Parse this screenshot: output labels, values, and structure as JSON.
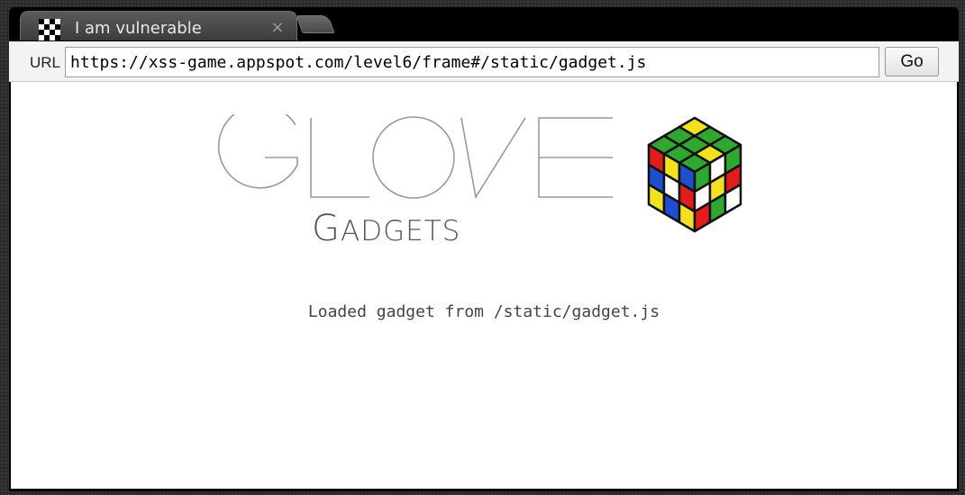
{
  "browser": {
    "tab": {
      "title": "I am vulnerable",
      "close_symbol": "×",
      "favicon": "xss-game-favicon-icon"
    },
    "new_tab": "new-tab-button",
    "toolbar": {
      "url_label": "URL",
      "url_value": "https://xss-game.appspot.com/level6/frame#/static/gadget.js",
      "go_label": "Go"
    }
  },
  "page": {
    "logo": {
      "title": "GLOVE",
      "subtitle_first": "G",
      "subtitle_rest": "ADGETS",
      "cube_icon": "rubiks-cube-icon"
    },
    "message": "Loaded gadget from /static/gadget.js"
  },
  "colors": {
    "page_background": "#ffffff",
    "frame": "#000000",
    "logo_stroke": "#999999",
    "message_text": "#444444"
  }
}
